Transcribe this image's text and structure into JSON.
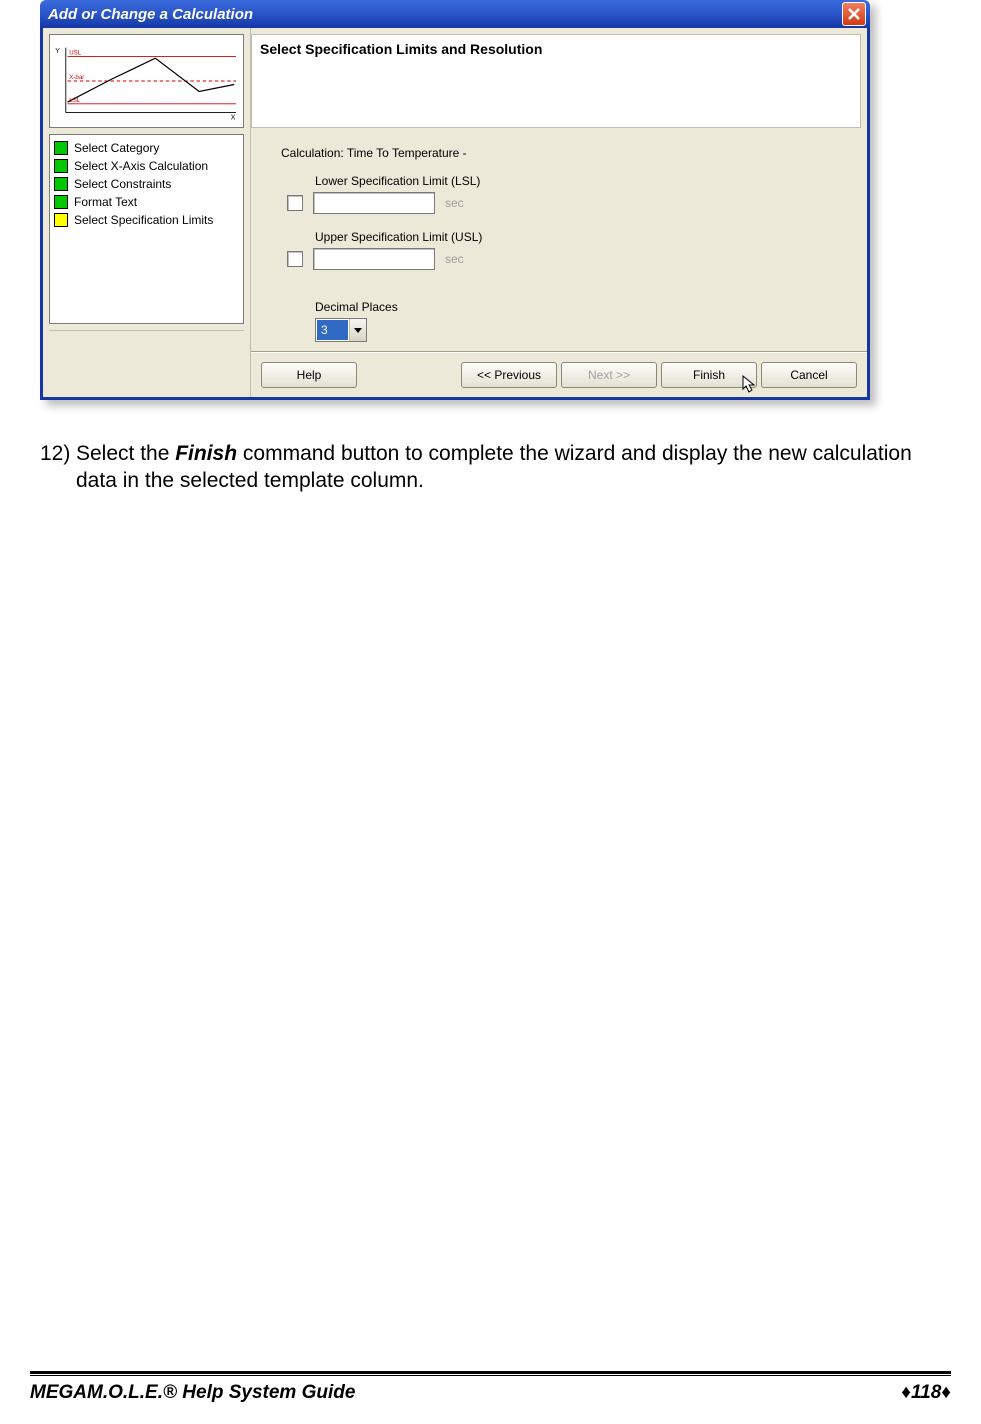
{
  "dialog": {
    "title": "Add or Change a Calculation",
    "heading": "Select Specification Limits and Resolution",
    "graph": {
      "y_label": "Y",
      "x_label": "X",
      "usl_label": "USL",
      "xbar_label": "X-bar",
      "lsl_label": "LSL"
    },
    "steps": [
      {
        "label": "Select Category",
        "color": "green"
      },
      {
        "label": "Select X-Axis Calculation",
        "color": "green"
      },
      {
        "label": "Select Constraints",
        "color": "green"
      },
      {
        "label": "Format Text",
        "color": "green"
      },
      {
        "label": "Select Specification Limits",
        "color": "yellow"
      }
    ],
    "calculation_label": "Calculation: Time To Temperature -",
    "lsl": {
      "label": "Lower Specification Limit (LSL)",
      "value": "",
      "unit": "sec"
    },
    "usl": {
      "label": "Upper Specification Limit (USL)",
      "value": "",
      "unit": "sec"
    },
    "decimal": {
      "label": "Decimal Places",
      "value": "3"
    },
    "buttons": {
      "help": "Help",
      "previous": "<< Previous",
      "next": "Next >>",
      "finish": "Finish",
      "cancel": "Cancel"
    }
  },
  "instruction": {
    "number": "12)",
    "pre": "Select the ",
    "bold": "Finish",
    "post": " command button to complete the wizard and display the new calculation data in the selected template column."
  },
  "footer": {
    "left_bold": "MEGA",
    "left_rest": "M.O.L.E.® Help System Guide",
    "page": "118"
  }
}
